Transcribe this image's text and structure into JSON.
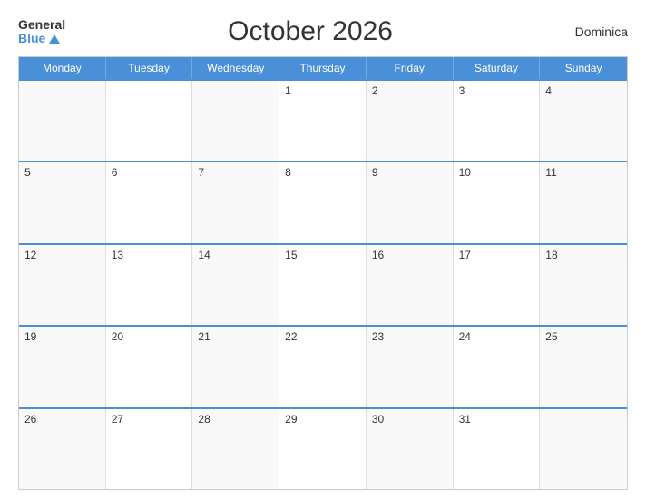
{
  "header": {
    "logo_general": "General",
    "logo_blue": "Blue",
    "title": "October 2026",
    "country": "Dominica"
  },
  "calendar": {
    "days_of_week": [
      "Monday",
      "Tuesday",
      "Wednesday",
      "Thursday",
      "Friday",
      "Saturday",
      "Sunday"
    ],
    "weeks": [
      [
        {
          "day": "",
          "empty": true
        },
        {
          "day": "",
          "empty": true
        },
        {
          "day": "",
          "empty": true
        },
        {
          "day": "1",
          "empty": false
        },
        {
          "day": "2",
          "empty": false
        },
        {
          "day": "3",
          "empty": false
        },
        {
          "day": "4",
          "empty": false
        }
      ],
      [
        {
          "day": "5",
          "empty": false
        },
        {
          "day": "6",
          "empty": false
        },
        {
          "day": "7",
          "empty": false
        },
        {
          "day": "8",
          "empty": false
        },
        {
          "day": "9",
          "empty": false
        },
        {
          "day": "10",
          "empty": false
        },
        {
          "day": "11",
          "empty": false
        }
      ],
      [
        {
          "day": "12",
          "empty": false
        },
        {
          "day": "13",
          "empty": false
        },
        {
          "day": "14",
          "empty": false
        },
        {
          "day": "15",
          "empty": false
        },
        {
          "day": "16",
          "empty": false
        },
        {
          "day": "17",
          "empty": false
        },
        {
          "day": "18",
          "empty": false
        }
      ],
      [
        {
          "day": "19",
          "empty": false
        },
        {
          "day": "20",
          "empty": false
        },
        {
          "day": "21",
          "empty": false
        },
        {
          "day": "22",
          "empty": false
        },
        {
          "day": "23",
          "empty": false
        },
        {
          "day": "24",
          "empty": false
        },
        {
          "day": "25",
          "empty": false
        }
      ],
      [
        {
          "day": "26",
          "empty": false
        },
        {
          "day": "27",
          "empty": false
        },
        {
          "day": "28",
          "empty": false
        },
        {
          "day": "29",
          "empty": false
        },
        {
          "day": "30",
          "empty": false
        },
        {
          "day": "31",
          "empty": false
        },
        {
          "day": "",
          "empty": true
        }
      ]
    ]
  }
}
